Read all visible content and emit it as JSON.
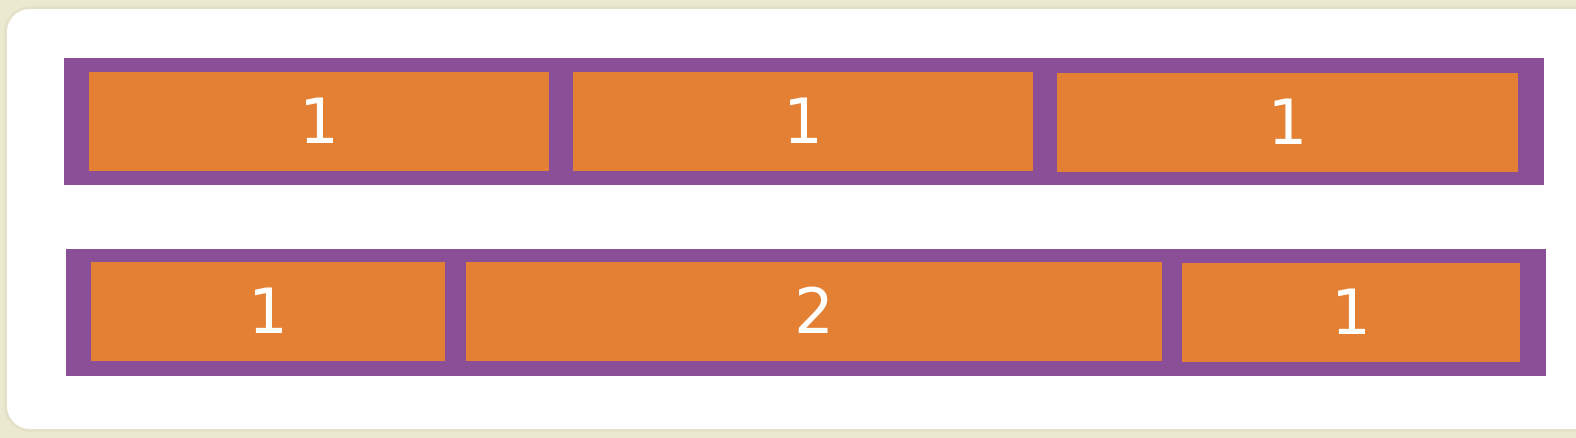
{
  "colors": {
    "container": "#8a4f97",
    "item": "#e48033",
    "text": "#ffffff",
    "page_background": "#ece9d1",
    "card_background": "#ffffff"
  },
  "rows": [
    {
      "items": [
        {
          "label": "1"
        },
        {
          "label": "1"
        },
        {
          "label": "1"
        }
      ]
    },
    {
      "items": [
        {
          "label": "1"
        },
        {
          "label": "2"
        },
        {
          "label": "1"
        }
      ]
    }
  ]
}
